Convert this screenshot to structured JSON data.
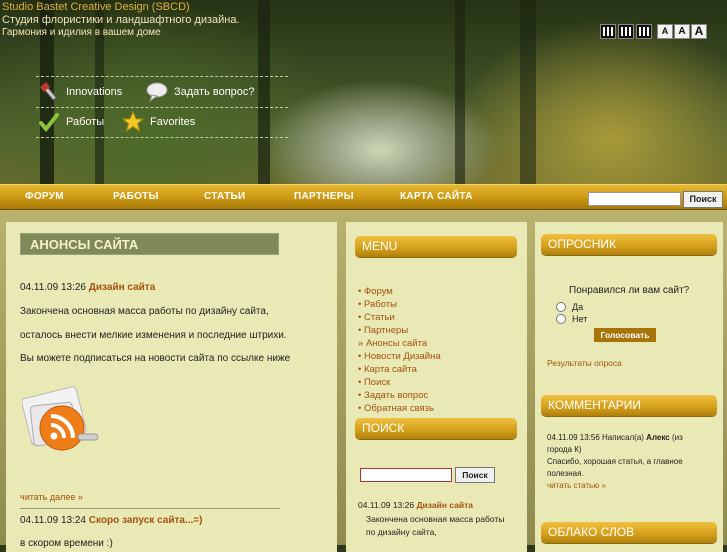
{
  "header": {
    "site_title": "Studio Bastet Creative Design (SBCD)",
    "subtitle_1": "Студия флористики и ландшафтного дизайна.",
    "subtitle_2": "Гармония и идилия в вашем доме",
    "font_buttons": [
      "A",
      "A",
      "A"
    ],
    "quick_links": {
      "innovations": "Innovations",
      "ask": "Задать вопрос?",
      "works": "Работы",
      "favorites": "Favorites"
    }
  },
  "navbar": {
    "items": [
      "ФОРУМ",
      "РАБОТЫ",
      "СТАТЬИ",
      "ПАРТНЕРЫ",
      "КАРТА САЙТА"
    ],
    "search_button": "Поиск"
  },
  "main": {
    "heading": "АНОНСЫ САЙТА",
    "news1": {
      "date": "04.11.09 13:26",
      "title": "Дизайн сайта",
      "line1": "Закончена основная масса работы по дизайну сайта,",
      "line2": "осталось внести мелкие изменения и последние штрихи.",
      "line3": "Вы можете подписаться на новости сайта по ссылке ниже"
    },
    "read_more": "читать далее »",
    "news2": {
      "date": "04.11.09 13:24",
      "title": "Скоро запуск сайта...=)",
      "line1": "в скором времени :)"
    }
  },
  "menu": {
    "heading": "MENU",
    "items": [
      "Форум",
      "Работы",
      "Статьи",
      "Партнеры",
      "Анонсы сайта",
      "Новости Дизайна",
      "Карта сайта",
      "Поиск",
      "Задать вопрос",
      "Обратная связь"
    ],
    "search_heading": "ПОИСК",
    "search_button": "Поиск",
    "news": {
      "date": "04.11.09 13:26",
      "title": "Дизайн сайта",
      "line1": "Закончена основная масса работы",
      "line2": "по дизайну сайта,"
    }
  },
  "poll": {
    "heading": "ОПРОСНИК",
    "question": "Понравился ли вам сайт?",
    "options": [
      "Да",
      "Нет"
    ],
    "vote_button": "Голосовать",
    "results_link": "Результаты опроса"
  },
  "comments": {
    "heading": "КОММЕНТАРИИ",
    "meta": "04.11.09 13:56 Написал(а)",
    "author": "Алекс",
    "author_suffix": "(из",
    "line2": "города К)",
    "line3": "Спасибо, хорошая статья, а главное",
    "line4": "полезная.",
    "read_link": "читать статью »"
  },
  "tag_cloud": {
    "heading": "ОБЛАКО СЛОВ"
  },
  "colors": {
    "accent": "#d39e1a",
    "link": "#a3520c",
    "panel_bg": "#e9e9b5"
  }
}
